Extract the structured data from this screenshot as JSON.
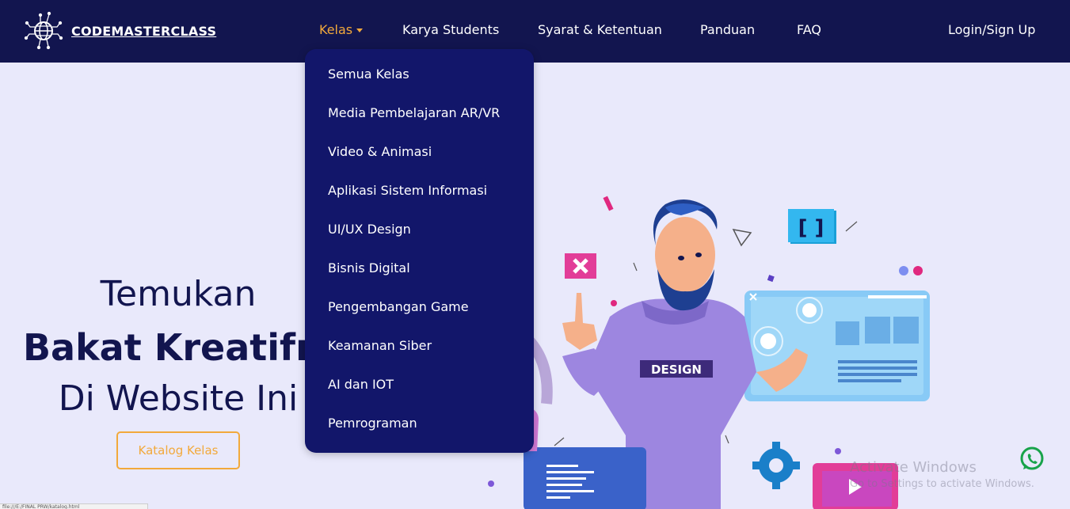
{
  "brand": {
    "name": "CODEMASTERCLASS",
    "logo_icon": "globe-circuit-icon"
  },
  "nav": {
    "items": [
      {
        "label": "Kelas",
        "active": true
      },
      {
        "label": "Karya Students"
      },
      {
        "label": "Syarat & Ketentuan"
      },
      {
        "label": "Panduan"
      },
      {
        "label": "FAQ"
      }
    ],
    "login": "Login/Sign Up"
  },
  "dropdown": {
    "items": [
      "Semua Kelas",
      "Media Pembelajaran AR/VR",
      "Video & Animasi",
      "Aplikasi Sistem Informasi",
      "UI/UX Design",
      "Bisnis Digital",
      "Pengembangan Game",
      "Keamanan Siber",
      "AI dan IOT",
      "Pemrograman"
    ]
  },
  "hero": {
    "line1": "Temukan",
    "line2": "Bakat Kreatifm",
    "line3": "Di Website Ini",
    "cta": "Katalog Kelas",
    "shirt_text": "DESIGN"
  },
  "watermark": {
    "title": "Activate Windows",
    "subtitle": "Go to Settings to activate Windows."
  },
  "statusbar": {
    "text": "file:///E:/FINAL PRW/katalog.html"
  },
  "colors": {
    "navbar": "#12154f",
    "dropdown": "#12166a",
    "accent": "#f2a93b",
    "hero_bg": "#e9e9fb"
  }
}
